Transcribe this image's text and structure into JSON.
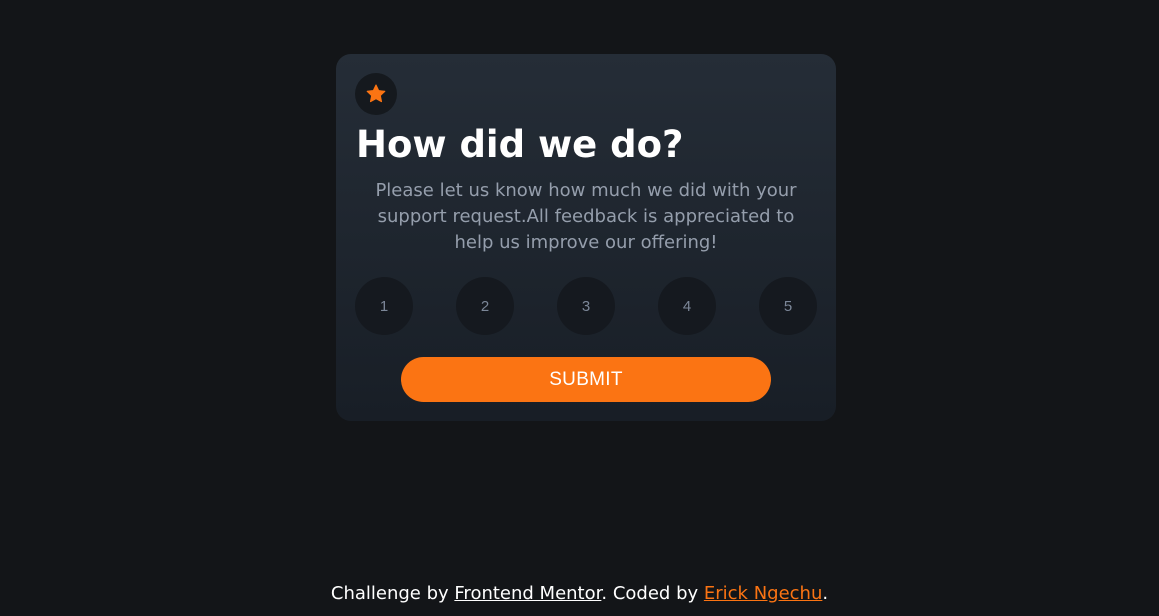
{
  "card": {
    "title": "How did we do?",
    "description": "Please let us know how much we did with your support request.All feedback is appreciated to help us improve our offering!",
    "star_icon": "star-icon",
    "ratings": [
      "1",
      "2",
      "3",
      "4",
      "5"
    ],
    "submit_label": "SUBMIT"
  },
  "footer": {
    "prefix": "Challenge by ",
    "fm_link": "Frontend Mentor",
    "middle": ". Coded by ",
    "author_link": "Erick Ngechu",
    "suffix": "."
  },
  "colors": {
    "background": "#131518",
    "card_gradient_top": "#252d37",
    "card_gradient_bottom": "#181e26",
    "accent": "#fb7413",
    "text_muted": "#959eac",
    "rating_bg": "#15191f",
    "rating_text": "#7c8798"
  }
}
